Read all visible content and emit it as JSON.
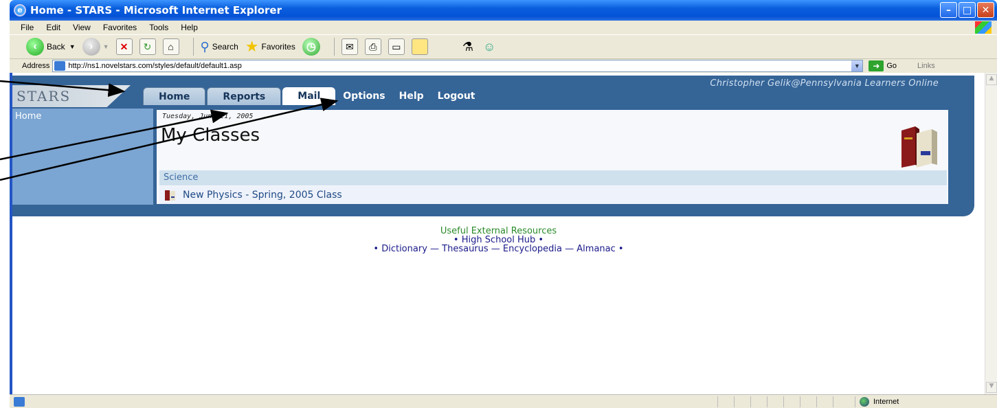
{
  "window": {
    "title": "Home - STARS - Microsoft Internet Explorer"
  },
  "menu": [
    "File",
    "Edit",
    "View",
    "Favorites",
    "Tools",
    "Help"
  ],
  "toolbar": {
    "back": "Back",
    "search": "Search",
    "favorites": "Favorites"
  },
  "address": {
    "label": "Address",
    "url": "http://ns1.novelstars.com/styles/default/default1.asp",
    "go": "Go",
    "links": "Links"
  },
  "site": {
    "logo": "STARS",
    "user": "Christopher Gelik@Pennsylvania Learners Online",
    "tabs": [
      "Home",
      "Reports",
      "Mail"
    ],
    "links": [
      "Options",
      "Help",
      "Logout"
    ],
    "nav_home": "Home",
    "date": "Tuesday, June 21, 2005",
    "heading": "My Classes",
    "section": "Science",
    "class_item": "New Physics - Spring, 2005 Class"
  },
  "resources": {
    "title": "Useful External Resources",
    "line1": "• High School Hub •",
    "line2": "• Dictionary — Thesaurus — Encyclopedia — Almanac •"
  },
  "status": {
    "zone": "Internet"
  }
}
